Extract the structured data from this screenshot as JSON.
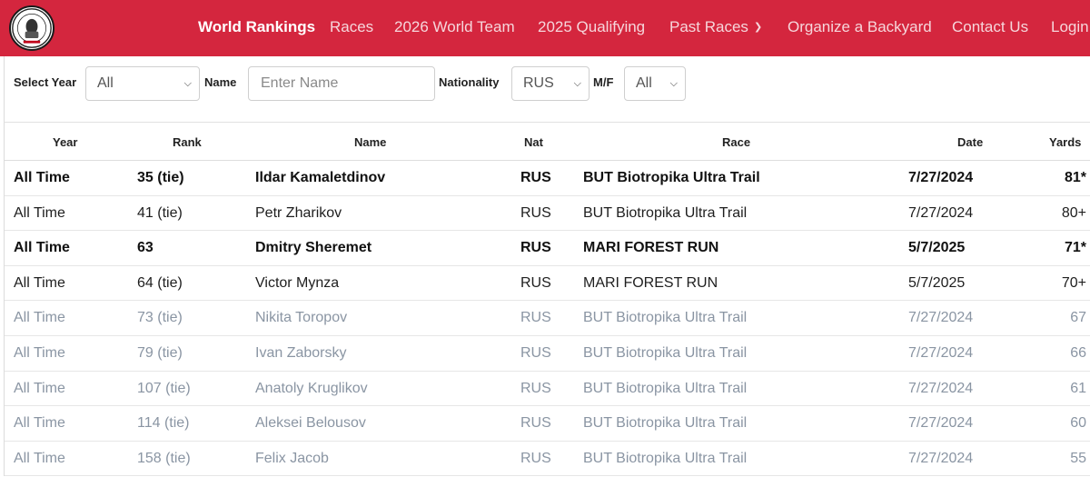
{
  "nav": {
    "items": [
      {
        "label": "World Rankings"
      },
      {
        "label": "Races"
      },
      {
        "label": "2026 World Team"
      },
      {
        "label": "2025 Qualifying"
      },
      {
        "label": "Past Races"
      },
      {
        "label": "Organize a Backyard"
      },
      {
        "label": "Contact Us"
      },
      {
        "label": "Login"
      }
    ]
  },
  "filters": {
    "year_label": "Select Year",
    "year_value": "All",
    "name_label": "Name",
    "name_placeholder": "Enter Name",
    "nationality_label": "Nationality",
    "nationality_value": "RUS",
    "sex_label": "M/F",
    "sex_value": "All"
  },
  "table": {
    "headers": [
      "Year",
      "Rank",
      "Name",
      "Nat",
      "Race",
      "Date",
      "Yards"
    ],
    "rows": [
      {
        "year": "All Time",
        "rank": "35 (tie)",
        "name": "Ildar Kamaletdinov",
        "nat": "RUS",
        "race": "BUT Biotropika Ultra Trail",
        "date": "7/27/2024",
        "yards": "81*",
        "style": "bold"
      },
      {
        "year": "All Time",
        "rank": "41 (tie)",
        "name": "Petr Zharikov",
        "nat": "RUS",
        "race": "BUT Biotropika Ultra Trail",
        "date": "7/27/2024",
        "yards": "80+",
        "style": "normal"
      },
      {
        "year": "All Time",
        "rank": "63",
        "name": "Dmitry Sheremet",
        "nat": "RUS",
        "race": "MARI FOREST RUN",
        "date": "5/7/2025",
        "yards": "71*",
        "style": "bold"
      },
      {
        "year": "All Time",
        "rank": "64 (tie)",
        "name": "Victor Mynza",
        "nat": "RUS",
        "race": "MARI FOREST RUN",
        "date": "5/7/2025",
        "yards": "70+",
        "style": "normal"
      },
      {
        "year": "All Time",
        "rank": "73 (tie)",
        "name": "Nikita Toropov",
        "nat": "RUS",
        "race": "BUT Biotropika Ultra Trail",
        "date": "7/27/2024",
        "yards": "67",
        "style": "dim"
      },
      {
        "year": "All Time",
        "rank": "79 (tie)",
        "name": "Ivan Zaborsky",
        "nat": "RUS",
        "race": "BUT Biotropika Ultra Trail",
        "date": "7/27/2024",
        "yards": "66",
        "style": "dim"
      },
      {
        "year": "All Time",
        "rank": "107 (tie)",
        "name": "Anatoly Kruglikov",
        "nat": "RUS",
        "race": "BUT Biotropika Ultra Trail",
        "date": "7/27/2024",
        "yards": "61",
        "style": "dim"
      },
      {
        "year": "All Time",
        "rank": "114 (tie)",
        "name": "Aleksei Belousov",
        "nat": "RUS",
        "race": "BUT Biotropika Ultra Trail",
        "date": "7/27/2024",
        "yards": "60",
        "style": "dim"
      },
      {
        "year": "All Time",
        "rank": "158 (tie)",
        "name": "Felix Jacob",
        "nat": "RUS",
        "race": "BUT Biotropika Ultra Trail",
        "date": "7/27/2024",
        "yards": "55",
        "style": "dim"
      }
    ]
  },
  "colors": {
    "brand": "#d4263e",
    "dim_text": "#8a95a3"
  },
  "icons": {
    "logo": "club-logo-icon",
    "dropdown": "chevron-down-icon"
  }
}
